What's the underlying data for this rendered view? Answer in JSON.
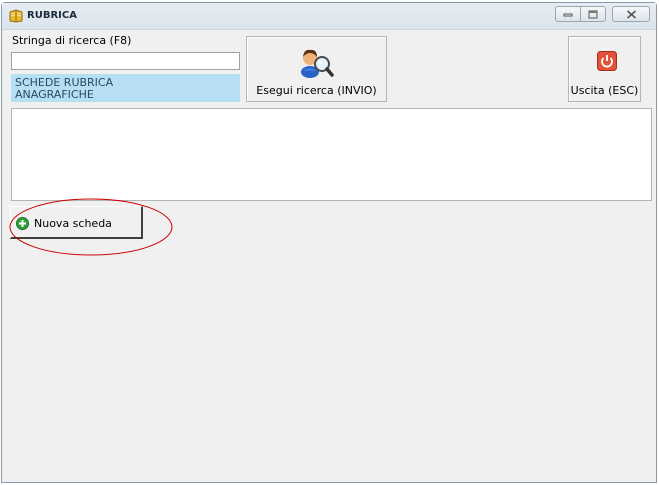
{
  "window": {
    "title": "RUBRICA"
  },
  "titlebar": {
    "buttons": [
      "minimize-icon",
      "maximize-icon",
      "close-icon"
    ]
  },
  "search": {
    "label": "Stringa di ricerca (F8)",
    "value": "",
    "placeholder": ""
  },
  "list": {
    "items": [
      "SCHEDE RUBRICA",
      "ANAGRAFICHE"
    ]
  },
  "buttons": {
    "search_label": "Esegui ricerca (INVIO)",
    "exit_label": "Uscita (ESC)",
    "new_label": "Nuova scheda"
  },
  "colors": {
    "accent_list": "#b6def5",
    "exit_icon": "#e0523a",
    "new_icon": "#2fa03a",
    "annotation": "#cc0000"
  }
}
